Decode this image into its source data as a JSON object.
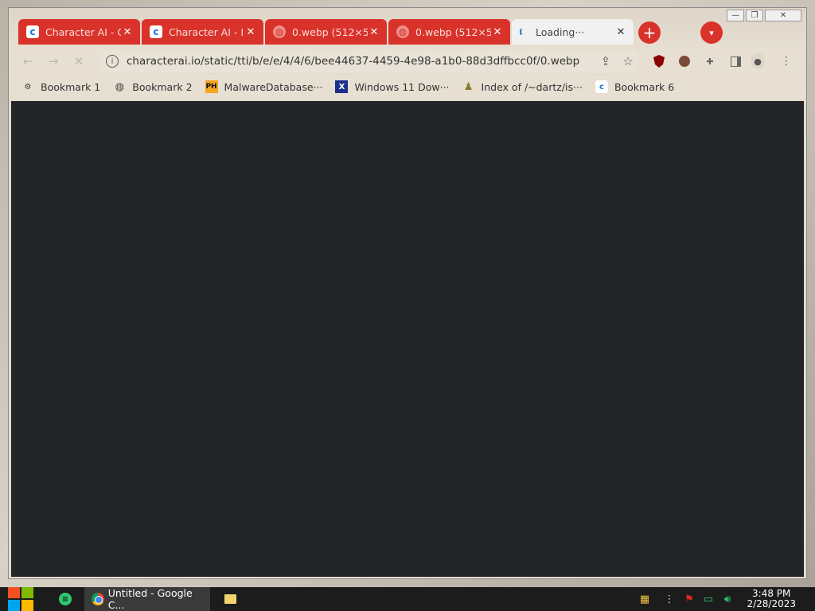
{
  "browser": {
    "tabs": [
      {
        "title": "Character AI - C",
        "favicon": "character-ai-icon",
        "active": false
      },
      {
        "title": "Character AI - I",
        "favicon": "character-ai-icon",
        "active": false
      },
      {
        "title": "0.webp (512×5",
        "favicon": "globe-icon",
        "active": false
      },
      {
        "title": "0.webp (512×5",
        "favicon": "globe-icon",
        "active": false
      },
      {
        "title": "Loading···",
        "favicon": "loading-spinner-icon",
        "active": true
      }
    ],
    "address": "characterai.io/static/tti/b/e/e/4/4/6/bee44637-4459-4e98-a1b0-88d3dffbcc0f/0.webp",
    "bookmarks": [
      {
        "label": "Bookmark 1",
        "icon": "gear-icon"
      },
      {
        "label": "Bookmark 2",
        "icon": "globe-icon"
      },
      {
        "label": "MalwareDatabase···",
        "icon": "ph-icon"
      },
      {
        "label": "Windows 11 Dow···",
        "icon": "x-icon"
      },
      {
        "label": "Index of /~dartz/is···",
        "icon": "people-icon"
      },
      {
        "label": "Bookmark 6",
        "icon": "character-ai-icon"
      }
    ],
    "accent_color": "#d9322b",
    "content_background": "#242526"
  },
  "taskbar": {
    "active_app": "Untitled - Google C...",
    "time": "3:48 PM",
    "date": "2/28/2023"
  }
}
